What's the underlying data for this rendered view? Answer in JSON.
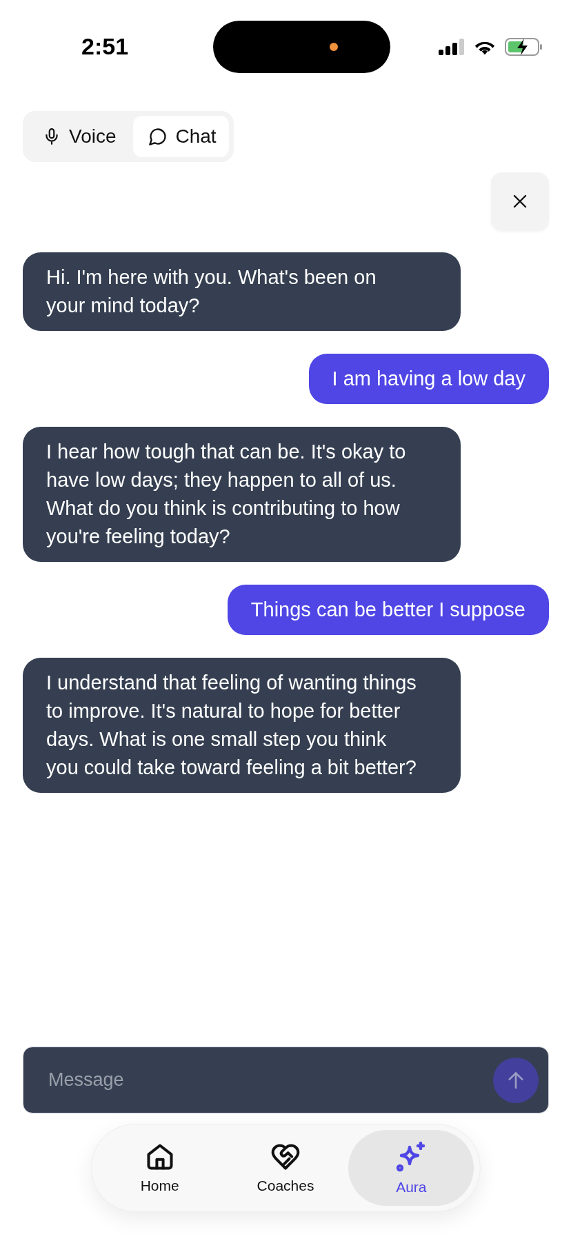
{
  "status_bar": {
    "time": "2:51"
  },
  "mode_tabs": [
    {
      "label": "Voice",
      "selected": false
    },
    {
      "label": "Chat",
      "selected": true
    }
  ],
  "messages": [
    {
      "kind": "assistant",
      "text": "Hi. I'm here with you. What's been on your mind today?"
    },
    {
      "kind": "user",
      "text": "I am having a low day"
    },
    {
      "kind": "assistant",
      "text": "I hear how tough that can be. It's okay to have low days; they happen to all of us. What do you think is contributing to how you're feeling today?"
    },
    {
      "kind": "user",
      "text": "Things can be better I suppose"
    },
    {
      "kind": "assistant",
      "text": "I understand that feeling of wanting things to improve. It's natural to hope for better days. What is one small step you think you could take toward feeling a bit better?"
    }
  ],
  "composer": {
    "placeholder": "Message"
  },
  "nav": [
    {
      "label": "Home",
      "selected": false
    },
    {
      "label": "Coaches",
      "selected": false
    },
    {
      "label": "Aura",
      "selected": true
    }
  ]
}
